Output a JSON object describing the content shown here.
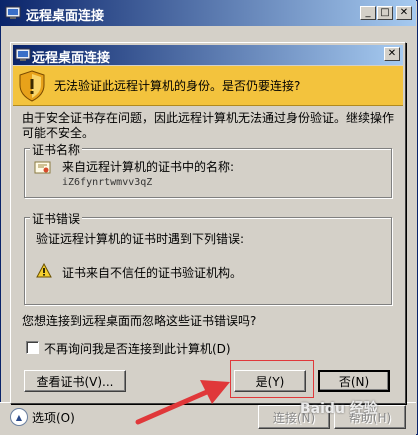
{
  "parent_window": {
    "title": "远程桌面连接",
    "options_label": "选项(O)",
    "connect_label": "连接(N)",
    "help_label": "帮助(H)"
  },
  "dialog": {
    "title": "远程桌面连接",
    "banner_text": "无法验证此远程计算机的身份。是否仍要连接?",
    "description": "由于安全证书存在问题，因此远程计算机无法通过身份验证。继续操作可能不安全。",
    "cert_name": {
      "legend": "证书名称",
      "from_label": "来自远程计算机的证书中的名称:",
      "name_value": "iZ6fynrtwmvv3qZ"
    },
    "cert_errors": {
      "legend": "证书错误",
      "intro": "验证远程计算机的证书时遇到下列错误:",
      "error_text": "证书来自不信任的证书验证机构。"
    },
    "question": "您想连接到远程桌面而忽略这些证书错误吗?",
    "dont_ask_label": "不再询问我是否连接到此计算机(D)",
    "dont_ask_checked": false,
    "view_cert_label": "查看证书(V)...",
    "yes_label": "是(Y)",
    "no_label": "否(N)"
  },
  "watermark": "Baidu 经验",
  "colors": {
    "banner": "#f3c33d",
    "title_bar_start": "#0a246a",
    "title_bar_end": "#a6caf0",
    "highlight_box": "#e0383a",
    "arrow": "#e0383a"
  }
}
